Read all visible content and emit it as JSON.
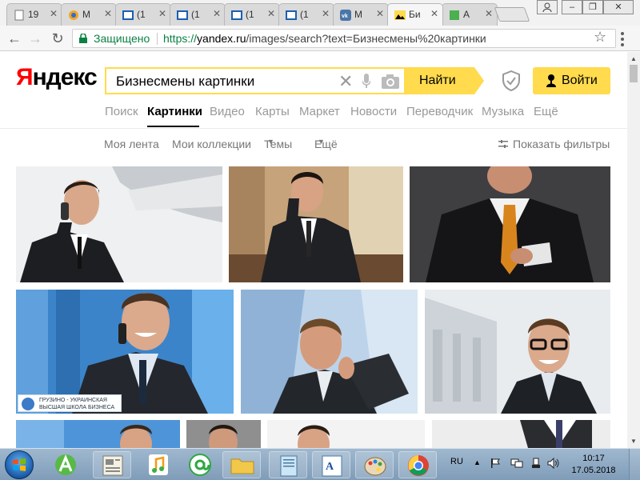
{
  "browser": {
    "tabs": [
      {
        "title": "19",
        "icon": "document-icon"
      },
      {
        "title": "M",
        "icon": "mail-icon"
      },
      {
        "title": "(1",
        "icon": "window-icon"
      },
      {
        "title": "(1",
        "icon": "window-icon"
      },
      {
        "title": "(1",
        "icon": "window-icon"
      },
      {
        "title": "(1",
        "icon": "window-icon"
      },
      {
        "title": "M",
        "icon": "vk-icon"
      },
      {
        "title": "Би",
        "icon": "image-icon"
      },
      {
        "title": "А",
        "icon": "green-square-icon"
      }
    ],
    "active_tab_index": 7,
    "secure_label": "Защищено",
    "url_scheme": "https://",
    "url_host": "yandex.ru",
    "url_path": "/images/search?text=Бизнесмены%20картинки"
  },
  "header": {
    "logo_first": "Я",
    "logo_rest": "ндекс",
    "search_query": "Бизнесмены картинки",
    "find_button": "Найти",
    "login_button": "Войти"
  },
  "services": {
    "items": [
      "Поиск",
      "Картинки",
      "Видео",
      "Карты",
      "Маркет",
      "Новости",
      "Переводчик",
      "Музыка",
      "Ещё"
    ],
    "selected_index": 1
  },
  "subnav": {
    "feed": "Моя лента",
    "collections": "Мои коллекции",
    "themes": "Темы",
    "more": "Ещё",
    "filters": "Показать фильтры"
  },
  "images": {
    "watermark_line1": "ГРУЗИНО - УКРАИНСКАЯ",
    "watermark_line2": "ВЫСШАЯ ШКОЛА БИЗНЕСА"
  },
  "taskbar": {
    "language": "RU",
    "time": "10:17",
    "date": "17.05.2018"
  },
  "colors": {
    "yandex_yellow": "#ffdb4d",
    "secure_green": "#0b8043",
    "logo_red": "#ff0000"
  }
}
